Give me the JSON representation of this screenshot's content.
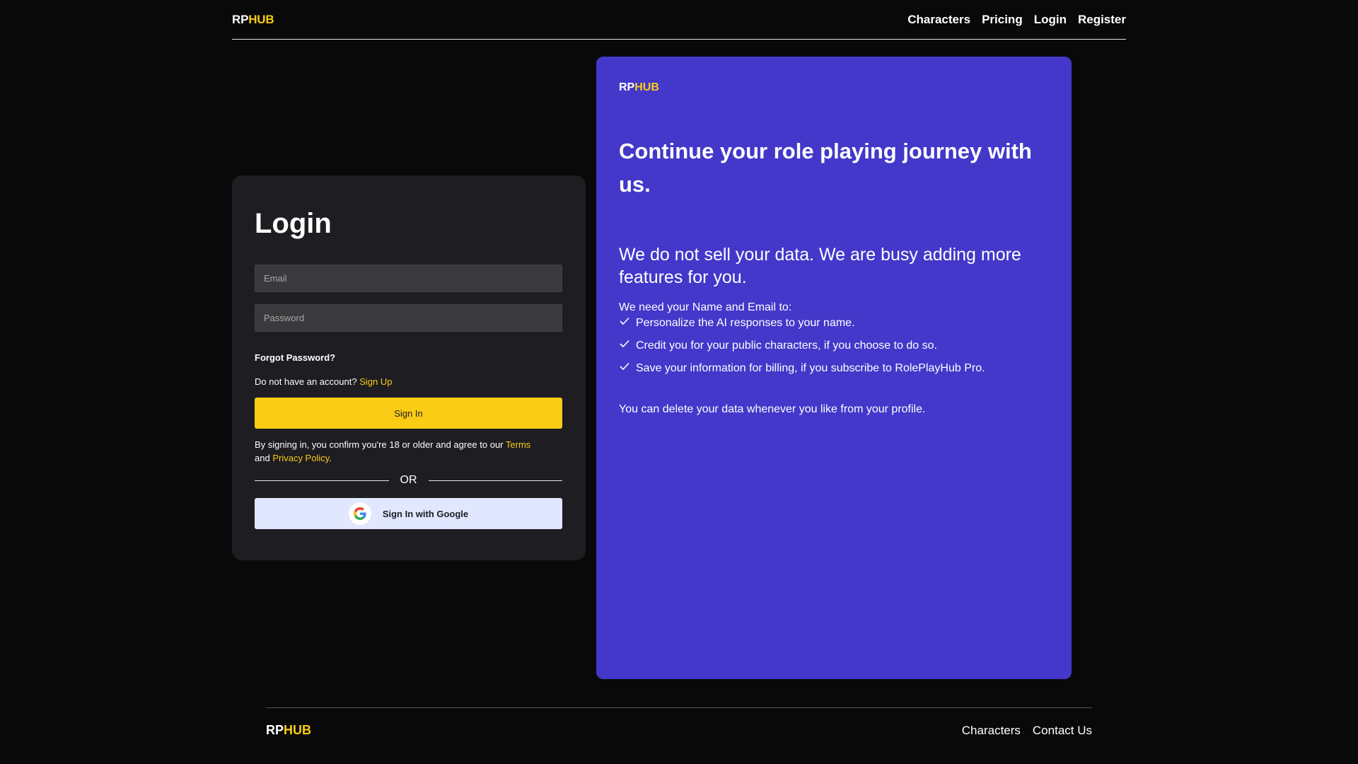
{
  "brand": {
    "part1": "RP",
    "part2": "HUB"
  },
  "header": {
    "nav": [
      "Characters",
      "Pricing",
      "Login",
      "Register"
    ]
  },
  "login": {
    "title": "Login",
    "email_placeholder": "Email",
    "password_placeholder": "Password",
    "forgot_label": "Forgot Password?",
    "no_account_text": "Do not have an account?",
    "signup_label": "Sign Up",
    "signin_label": "Sign In",
    "terms_prefix": "By signing in, you confirm you're 18 or older and agree to our",
    "terms_label": "Terms",
    "terms_and": "and",
    "privacy_label": "Privacy Policy",
    "terms_suffix": ".",
    "or_label": "OR",
    "google_label": "Sign In with Google",
    "google_icon": "google-g-icon"
  },
  "promo": {
    "heading": "Continue your role playing journey with us.",
    "subheading": "We do not sell your data. We are busy adding more features for you.",
    "need_intro": "We need your Name and Email to:",
    "items": [
      "Personalize the AI responses to your name.",
      "Credit you for your public characters, if you choose to do so.",
      "Save your information for billing, if you subscribe to RolePlayHub Pro."
    ],
    "delete_note": "You can delete your data whenever you like from your profile."
  },
  "footer": {
    "nav": [
      "Characters",
      "Contact Us"
    ]
  },
  "colors": {
    "background": "#0a0909",
    "accent": "#facc15",
    "panel": "#4338ca",
    "card": "#1d1d22",
    "google_button": "#e0e7ff"
  }
}
